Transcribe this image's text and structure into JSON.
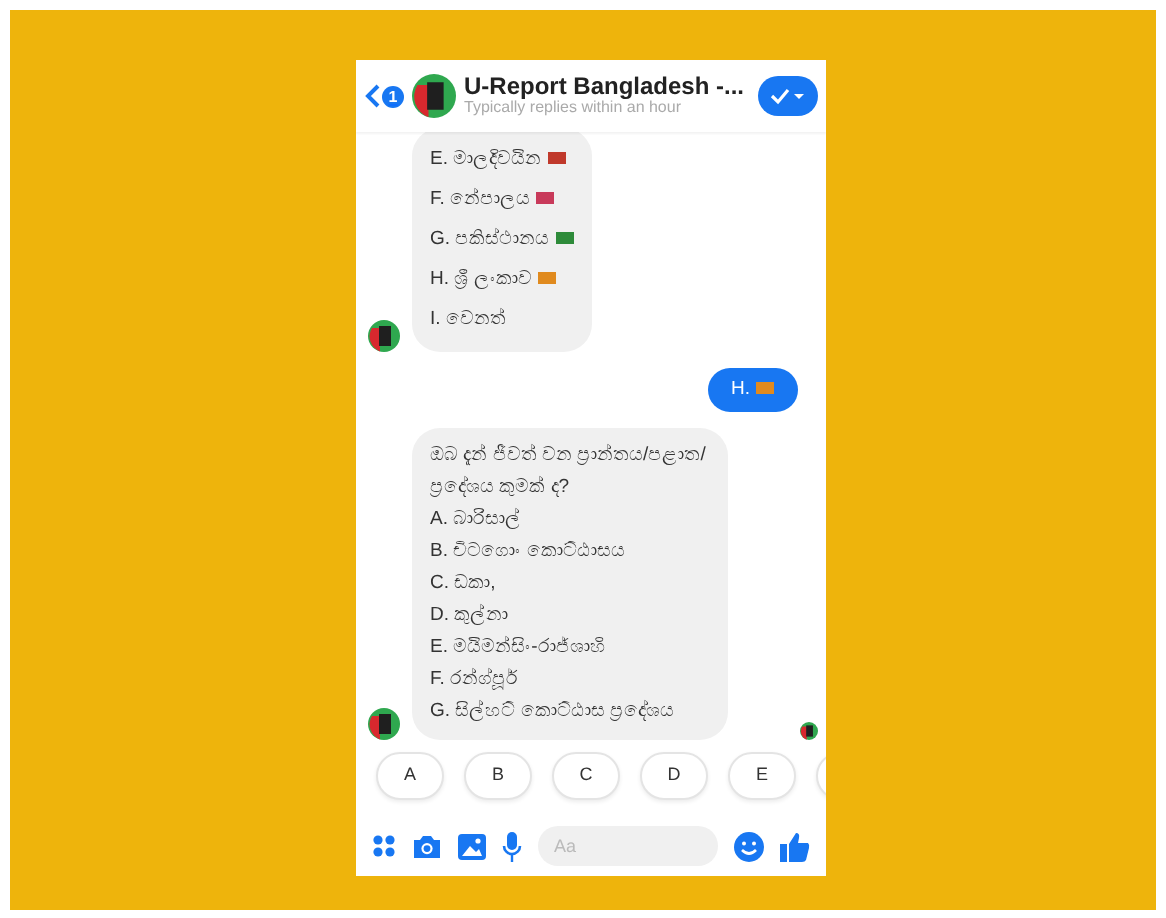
{
  "header": {
    "back_badge": "1",
    "title": "U-Report Bangladesh -...",
    "subtitle": "Typically replies within an hour"
  },
  "messages": [
    {
      "kind": "received",
      "lines": [
        {
          "text": "E. මාලදිවයින",
          "color": "#c0392b"
        },
        {
          "text": "F. නේපාලය",
          "color": "#c83a5a"
        },
        {
          "text": "G. පකිස්ථානය",
          "color": "#2e8b3a"
        },
        {
          "text": "H. ශ්‍රී ලංකාව",
          "color": "#e08a1e"
        },
        {
          "text": "I. වෙනත්"
        }
      ]
    },
    {
      "kind": "sent",
      "lines": [
        {
          "text": "H.",
          "color": "#e08a1e"
        }
      ]
    },
    {
      "kind": "received",
      "lines": [
        {
          "text": "ඔබ දැන් ජීවත් වන ප්‍රාන්තය/පළාත/ප්‍රදේශය කුමක් ද?"
        },
        {
          "text": "A. බාරිසාල්"
        },
        {
          "text": "B. චිටගොං කොට්ඨාසය"
        },
        {
          "text": "C. ඩකා,"
        },
        {
          "text": "D. කුල්නා"
        },
        {
          "text": "E. මයිමන්සිං-රාජ්ශාහි"
        },
        {
          "text": "F. රන්ග්පූර්"
        },
        {
          "text": "G. සිල්හට් කොට්ඨාස ප්‍රදේශය"
        }
      ]
    }
  ],
  "quick_replies": [
    "A",
    "B",
    "C",
    "D",
    "E"
  ],
  "composer": {
    "placeholder": "Aa"
  }
}
